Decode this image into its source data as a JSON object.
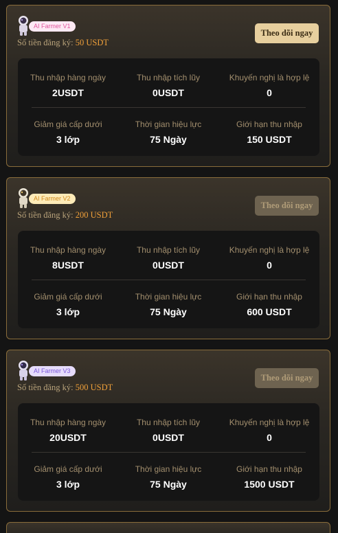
{
  "plans": [
    {
      "tier": "AI Farmer V1",
      "amount_label": "Số tiền đăng ký:",
      "amount": "50 USDT",
      "button": "Theo dõi ngay",
      "stats": [
        {
          "label": "Thu nhập hàng ngày",
          "value": "2USDT"
        },
        {
          "label": "Thu nhập tích lũy",
          "value": "0USDT"
        },
        {
          "label": "Khuyến nghị là hợp lệ",
          "value": "0"
        },
        {
          "label": "Giảm giá cấp dưới",
          "value": "3 lớp"
        },
        {
          "label": "Thời gian hiệu lực",
          "value": "75 Ngày"
        },
        {
          "label": "Giới hạn thu nhập",
          "value": "150 USDT"
        }
      ]
    },
    {
      "tier": "AI Farmer V2",
      "amount_label": "Số tiền đăng ký:",
      "amount": "200 USDT",
      "button": "Theo dõi ngay",
      "stats": [
        {
          "label": "Thu nhập hàng ngày",
          "value": "8USDT"
        },
        {
          "label": "Thu nhập tích lũy",
          "value": "0USDT"
        },
        {
          "label": "Khuyến nghị là hợp lệ",
          "value": "0"
        },
        {
          "label": "Giảm giá cấp dưới",
          "value": "3 lớp"
        },
        {
          "label": "Thời gian hiệu lực",
          "value": "75 Ngày"
        },
        {
          "label": "Giới hạn thu nhập",
          "value": "600 USDT"
        }
      ]
    },
    {
      "tier": "AI Farmer V3",
      "amount_label": "Số tiền đăng ký:",
      "amount": "500 USDT",
      "button": "Theo dõi ngay",
      "stats": [
        {
          "label": "Thu nhập hàng ngày",
          "value": "20USDT"
        },
        {
          "label": "Thu nhập tích lũy",
          "value": "0USDT"
        },
        {
          "label": "Khuyến nghị là hợp lệ",
          "value": "0"
        },
        {
          "label": "Giảm giá cấp dưới",
          "value": "3 lớp"
        },
        {
          "label": "Thời gian hiệu lực",
          "value": "75 Ngày"
        },
        {
          "label": "Giới hạn thu nhập",
          "value": "1500 USDT"
        }
      ]
    }
  ],
  "colors": {
    "card_border": "#8a6d3b",
    "amount_accent": "#f0a03a",
    "label_text": "#a38f6e",
    "button_active": "#e7cf9e",
    "button_muted": "#6e6350"
  },
  "icons": {
    "avatar": "astronaut-icon"
  }
}
